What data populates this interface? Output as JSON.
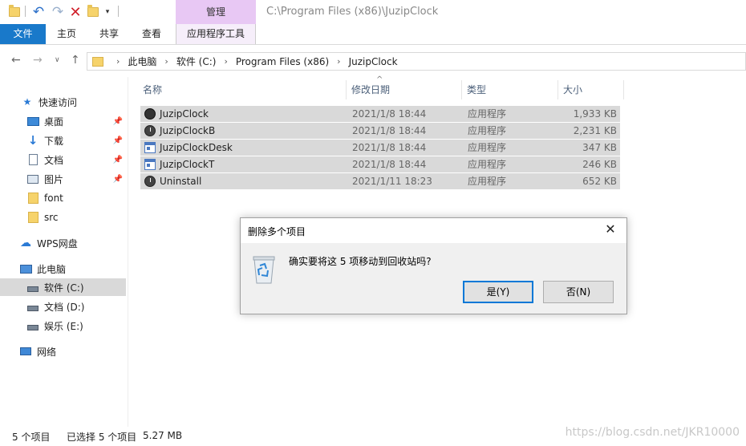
{
  "window": {
    "title_path": "C:\\Program Files (x86)\\JuzipClock",
    "manage_tab": "管理"
  },
  "ribbon": {
    "tabs": [
      {
        "label": "文件"
      },
      {
        "label": "主页"
      },
      {
        "label": "共享"
      },
      {
        "label": "查看"
      },
      {
        "label": "应用程序工具"
      }
    ]
  },
  "address": {
    "crumbs": [
      "此电脑",
      "软件 (C:)",
      "Program Files (x86)",
      "JuzipClock"
    ]
  },
  "sidebar": {
    "items": [
      {
        "label": "快速访问",
        "icon": "star-icon"
      },
      {
        "label": "桌面",
        "icon": "desktop-icon",
        "pinned": true
      },
      {
        "label": "下载",
        "icon": "download-icon",
        "pinned": true
      },
      {
        "label": "文档",
        "icon": "document-icon",
        "pinned": true
      },
      {
        "label": "图片",
        "icon": "picture-icon",
        "pinned": true
      },
      {
        "label": "font",
        "icon": "folder-icon"
      },
      {
        "label": "src",
        "icon": "folder-icon"
      },
      {
        "label": "WPS网盘",
        "icon": "cloud-icon"
      },
      {
        "label": "此电脑",
        "icon": "computer-icon"
      },
      {
        "label": "软件 (C:)",
        "icon": "drive-icon",
        "selected": true
      },
      {
        "label": "文档 (D:)",
        "icon": "drive-icon"
      },
      {
        "label": "娱乐 (E:)",
        "icon": "drive-icon"
      },
      {
        "label": "网络",
        "icon": "network-icon"
      }
    ]
  },
  "columns": {
    "name": "名称",
    "date": "修改日期",
    "type": "类型",
    "size": "大小"
  },
  "files": [
    {
      "name": "JuzipClock",
      "date": "2021/1/8 18:44",
      "type": "应用程序",
      "size": "1,933 KB",
      "icon": "app-dark-icon"
    },
    {
      "name": "JuzipClockB",
      "date": "2021/1/8 18:44",
      "type": "应用程序",
      "size": "2,231 KB",
      "icon": "clock-icon"
    },
    {
      "name": "JuzipClockDesk",
      "date": "2021/1/8 18:44",
      "type": "应用程序",
      "size": "347 KB",
      "icon": "window-app-icon"
    },
    {
      "name": "JuzipClockT",
      "date": "2021/1/8 18:44",
      "type": "应用程序",
      "size": "246 KB",
      "icon": "window-app-icon"
    },
    {
      "name": "Uninstall",
      "date": "2021/1/11 18:23",
      "type": "应用程序",
      "size": "652 KB",
      "icon": "clock-icon"
    }
  ],
  "status": {
    "count": "5 个项目",
    "selected": "已选择 5 个项目",
    "size": "5.27 MB"
  },
  "watermark": "https://blog.csdn.net/JKR10000",
  "dialog": {
    "title": "删除多个项目",
    "message": "确实要将这 5 项移动到回收站吗?",
    "yes": "是(Y)",
    "no": "否(N)",
    "close": "✕"
  }
}
